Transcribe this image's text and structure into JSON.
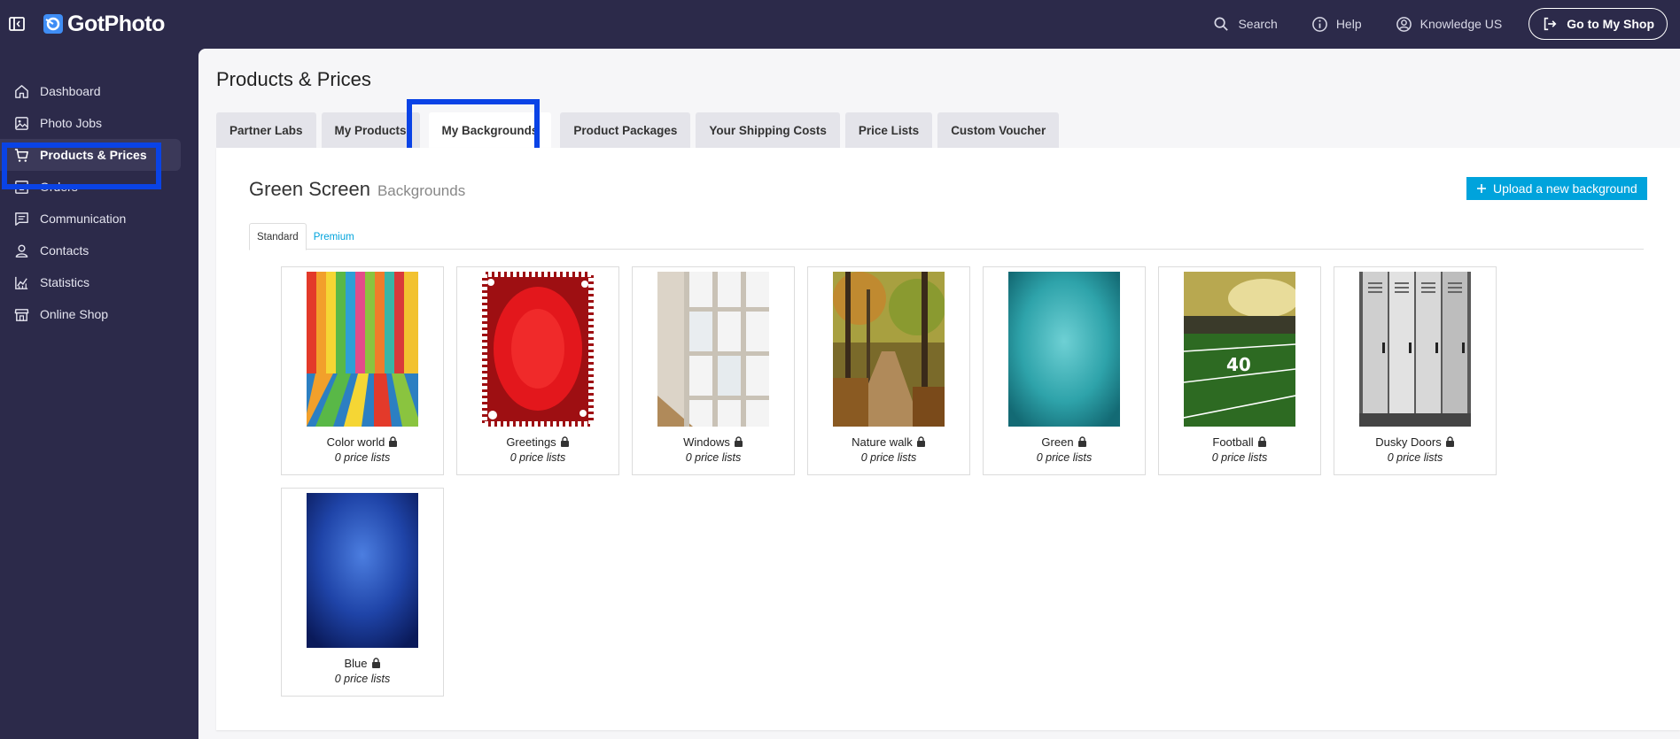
{
  "app": {
    "name": "GotPhoto"
  },
  "topbar": {
    "search_label": "Search",
    "help_label": "Help",
    "account_label": "Knowledge US",
    "shop_button_label": "Go to My Shop"
  },
  "sidebar": {
    "items": [
      {
        "label": "Dashboard",
        "icon": "home-icon"
      },
      {
        "label": "Photo Jobs",
        "icon": "image-icon"
      },
      {
        "label": "Products & Prices",
        "icon": "cart-icon",
        "active": true
      },
      {
        "label": "Orders",
        "icon": "inbox-icon"
      },
      {
        "label": "Communication",
        "icon": "message-icon"
      },
      {
        "label": "Contacts",
        "icon": "person-icon"
      },
      {
        "label": "Statistics",
        "icon": "chart-icon"
      },
      {
        "label": "Online Shop",
        "icon": "store-icon"
      }
    ]
  },
  "page": {
    "title": "Products & Prices"
  },
  "tabs": [
    {
      "label": "Partner Labs"
    },
    {
      "label": "My Products"
    },
    {
      "label": "My Backgrounds",
      "active": true
    },
    {
      "label": "Product Packages"
    },
    {
      "label": "Your Shipping Costs"
    },
    {
      "label": "Price Lists"
    },
    {
      "label": "Custom Voucher"
    }
  ],
  "section": {
    "title": "Green Screen",
    "subtitle": "Backgrounds",
    "upload_label": "Upload a new background",
    "subtabs": [
      {
        "label": "Standard",
        "active": true
      },
      {
        "label": "Premium"
      }
    ]
  },
  "backgrounds": [
    {
      "name": "Color world",
      "price_lists": "0 price lists"
    },
    {
      "name": "Greetings",
      "price_lists": "0 price lists"
    },
    {
      "name": "Windows",
      "price_lists": "0 price lists"
    },
    {
      "name": "Nature walk",
      "price_lists": "0 price lists"
    },
    {
      "name": "Green",
      "price_lists": "0 price lists"
    },
    {
      "name": "Football",
      "price_lists": "0 price lists"
    },
    {
      "name": "Dusky Doors",
      "price_lists": "0 price lists"
    },
    {
      "name": "Blue",
      "price_lists": "0 price lists"
    }
  ],
  "colors": {
    "sidebar_bg": "#2c2a4a",
    "accent": "#00a3dc",
    "highlight": "#0a43e6"
  }
}
